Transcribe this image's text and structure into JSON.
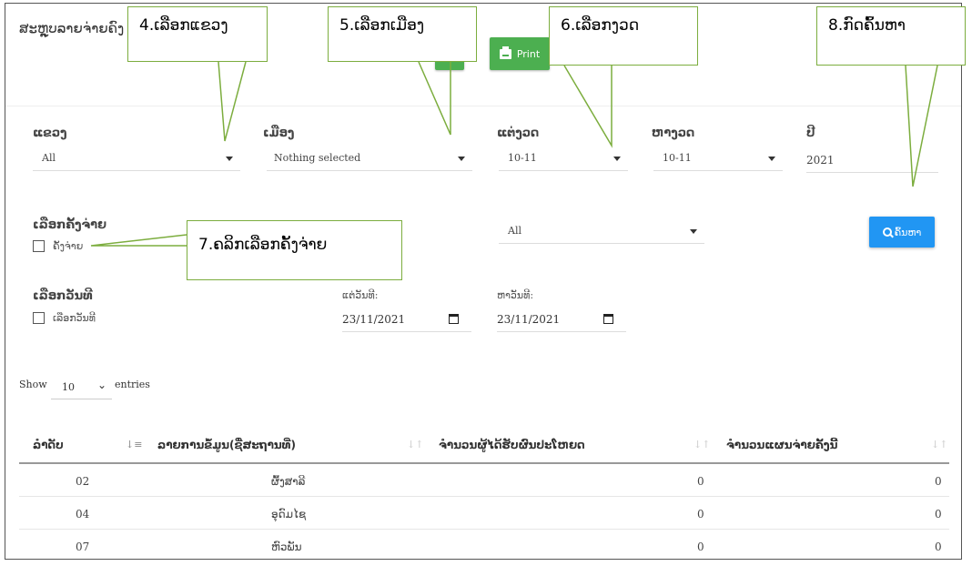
{
  "header": {
    "title": "ສະຫຼຸບລາຍຈ່າຍຄົງ",
    "print_label": "Print"
  },
  "filters": {
    "province": {
      "label": "ແຂວງ",
      "value": "All"
    },
    "district": {
      "label": "ເມືອງ",
      "value": "Nothing selected"
    },
    "from_period": {
      "label": "ແຕ່ງວດ",
      "value": "10-11"
    },
    "to_period": {
      "label": "ຫາງວດ",
      "value": "10-11"
    },
    "year": {
      "label": "ປີ",
      "value": "2021"
    },
    "select_payment": {
      "label": "ເລືອກຄັ້ງຈ່າຍ",
      "checkbox_label": "ຄັ້ງຈ່າຍ"
    },
    "payment_select_value": "All",
    "select_date": {
      "label": "ເລືອກວັນທີ",
      "checkbox_label": "ເລືອກວັນທີ"
    },
    "from_date": {
      "label": "ແຕ່ວັນທີ:",
      "value": "23/11/2021"
    },
    "to_date": {
      "label": "ຫາວັນທີ:",
      "value": "23/11/2021"
    },
    "search_label": "ຄົ້ນຫາ"
  },
  "entries": {
    "show": "Show",
    "value": "10",
    "suffix": "entries"
  },
  "table": {
    "columns": [
      "ລຳດັບ",
      "ລາຍການຂໍ້ມູນ(ຊື່ສະຖານທີ່)",
      "ຈຳນວນຜູ້ໄດ້ຮັບຜົນປະໂຫຍດ",
      "ຈຳນວນແຜນຈ່າຍຄັ້ງນີ້"
    ],
    "rows": [
      {
        "no": "02",
        "name": "ຜົ້ງສາລີ",
        "beneficiaries": "0",
        "plan": "0"
      },
      {
        "no": "04",
        "name": "ອຸດົມໄຊ",
        "beneficiaries": "0",
        "plan": "0"
      },
      {
        "no": "07",
        "name": "ຫົວພັນ",
        "beneficiaries": "0",
        "plan": "0"
      }
    ]
  },
  "callouts": {
    "c4": "4.ເລືອກແຂວງ",
    "c5": "5.ເລືອກເມືອງ",
    "c6": "6.ເລືອກງວດ",
    "c7": "7.ຄລິກເລືອກຄັ້ງຈ່າຍ",
    "c8": "8.ກົດຄົ້ນຫາ"
  },
  "colors": {
    "green": "#4caf50",
    "blue": "#2196f3",
    "callout_border": "#7cad3e"
  }
}
